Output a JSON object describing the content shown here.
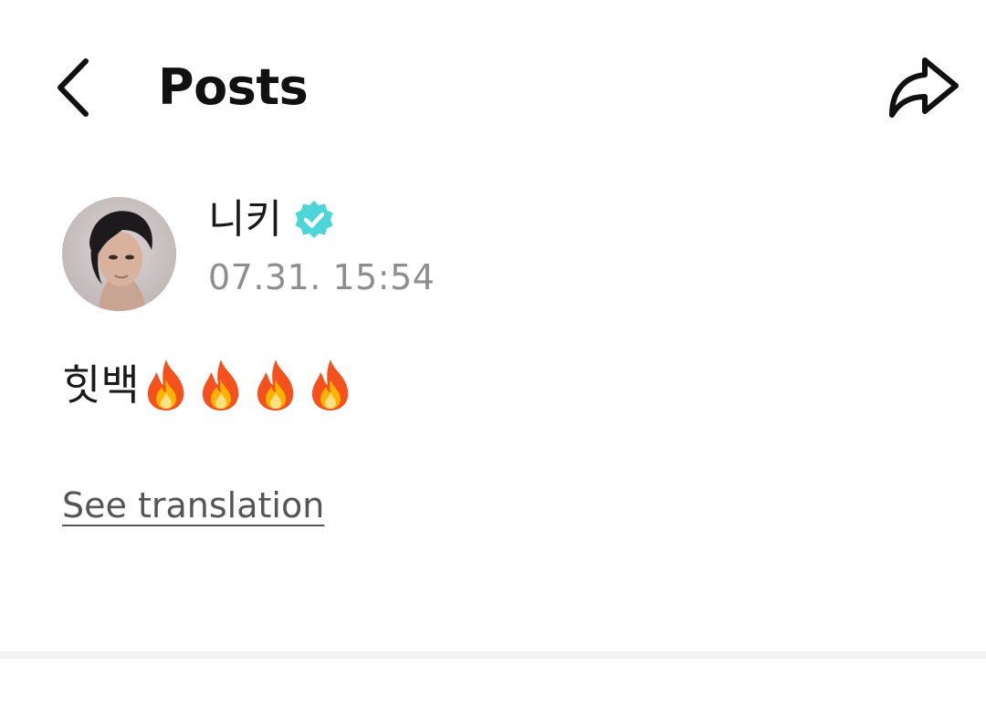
{
  "header": {
    "back_icon": "chevron-left-icon",
    "title": "Posts",
    "share_icon": "share-arrow-icon"
  },
  "post": {
    "author": {
      "name": "니키",
      "verified_icon": "verified-badge-icon",
      "verified_color": "#4dd5d8"
    },
    "timestamp": "07.31. 15:54",
    "text": "힛백",
    "emoji": [
      "fire",
      "fire",
      "fire",
      "fire"
    ],
    "see_translation_label": "See translation"
  }
}
